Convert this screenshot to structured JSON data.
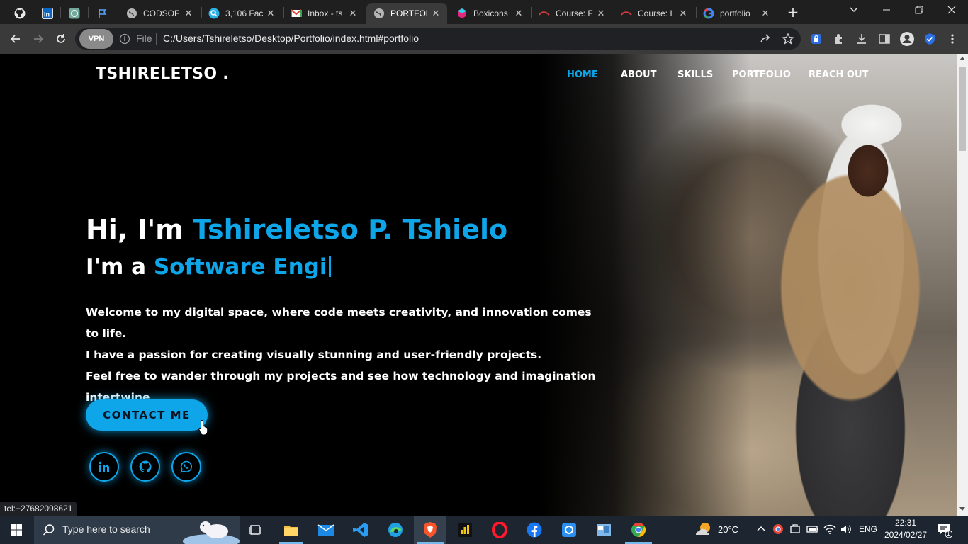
{
  "browser": {
    "tabs": [
      {
        "label": "",
        "icon": "github-icon",
        "pinned": true
      },
      {
        "label": "",
        "icon": "linkedin-icon",
        "pinned": true
      },
      {
        "label": "",
        "icon": "chatgpt-icon",
        "pinned": true
      },
      {
        "label": "",
        "icon": "flag-icon",
        "pinned": true
      },
      {
        "label": "CODSOF",
        "icon": "globe-icon"
      },
      {
        "label": "3,106 Fac",
        "icon": "search-engine-icon"
      },
      {
        "label": "Inbox - ts",
        "icon": "gmail-icon"
      },
      {
        "label": "PORTFOL",
        "icon": "globe-icon",
        "active": true
      },
      {
        "label": "Boxicons",
        "icon": "boxicons-icon"
      },
      {
        "label": "Course: F",
        "icon": "course-icon"
      },
      {
        "label": "Course: I",
        "icon": "course-icon"
      },
      {
        "label": "portfolio",
        "icon": "google-icon"
      }
    ],
    "vpn_label": "VPN",
    "file_label": "File",
    "url": "C:/Users/Tshireletso/Desktop/Portfolio/index.html#portfolio",
    "status_link": "tel:+27682098621"
  },
  "page": {
    "logo": "TSHIRELETSO .",
    "nav": [
      "HOME",
      "ABOUT",
      "SKILLS",
      "PORTFOLIO",
      "REACH OUT"
    ],
    "active_nav": "HOME",
    "greeting_prefix": "Hi, I'm ",
    "name": "Tshireletso P. Tshielo",
    "role_prefix": "I'm a ",
    "role_typed": "Software Engi",
    "intro_lines": [
      "Welcome to my digital space, where code meets creativity, and innovation comes to life.",
      "I have a passion for creating visually stunning and user-friendly projects.",
      "Feel free to wander through my projects and see how technology and imagination",
      "intertwine."
    ],
    "contact_button": "CONTACT ME",
    "social": [
      "linkedin-icon",
      "github-icon",
      "whatsapp-icon"
    ],
    "accent_color": "#0ea5e9"
  },
  "taskbar": {
    "search_placeholder": "Type here to search",
    "weather": "20°C",
    "language": "ENG",
    "time": "22:31",
    "date": "2024/02/27",
    "notifications": "1"
  }
}
